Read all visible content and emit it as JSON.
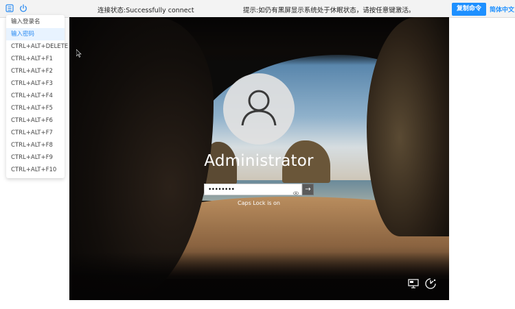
{
  "topbar": {
    "status_text": "连接状态:Successfully connect",
    "hint_text": "提示:如仍有黑屏显示系统处于休眠状态，请按任意键激活。",
    "copy_button_label": "复制命令",
    "language_label": "简体中文",
    "icons": [
      "keyboard-icon",
      "power-icon"
    ]
  },
  "command_menu": {
    "items": [
      {
        "label": "输入登录名",
        "active": false
      },
      {
        "label": "输入密码",
        "active": true
      },
      {
        "label": "CTRL+ALT+DELETE",
        "active": false
      },
      {
        "label": "CTRL+ALT+F1",
        "active": false
      },
      {
        "label": "CTRL+ALT+F2",
        "active": false
      },
      {
        "label": "CTRL+ALT+F3",
        "active": false
      },
      {
        "label": "CTRL+ALT+F4",
        "active": false
      },
      {
        "label": "CTRL+ALT+F5",
        "active": false
      },
      {
        "label": "CTRL+ALT+F6",
        "active": false
      },
      {
        "label": "CTRL+ALT+F7",
        "active": false
      },
      {
        "label": "CTRL+ALT+F8",
        "active": false
      },
      {
        "label": "CTRL+ALT+F9",
        "active": false
      },
      {
        "label": "CTRL+ALT+F10",
        "active": false
      }
    ]
  },
  "login_screen": {
    "username": "Administrator",
    "password_masked": "••••••••",
    "caps_lock_message": "Caps Lock is on",
    "corner_icons": [
      "network-icon",
      "accessibility-icon"
    ]
  },
  "colors": {
    "accent": "#1e90ff",
    "menu_active_bg": "#e8f3ff",
    "menu_active_text": "#2a8bf2"
  }
}
